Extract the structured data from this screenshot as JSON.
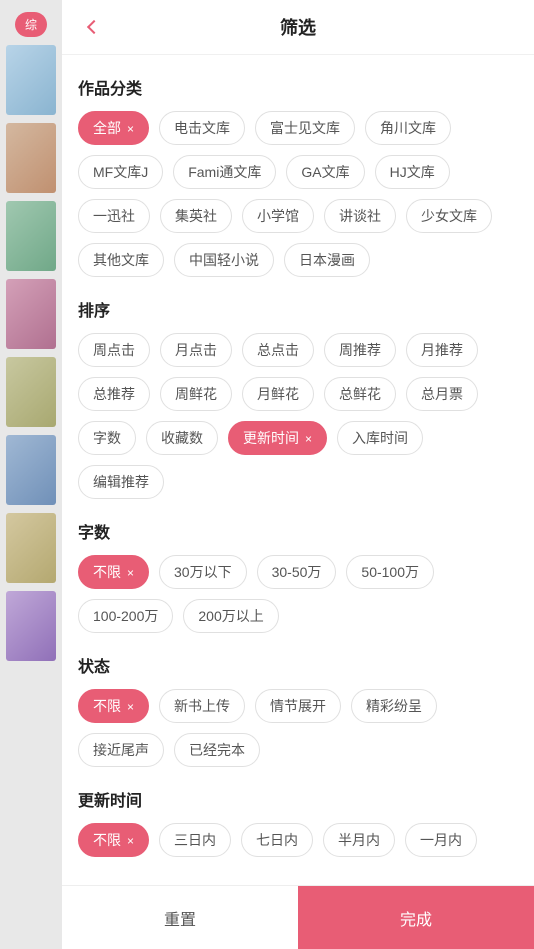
{
  "header": {
    "title": "筛选",
    "back_label": "back"
  },
  "sections": {
    "category": {
      "title": "作品分类",
      "tags": [
        {
          "label": "全部",
          "active": true
        },
        {
          "label": "电击文库",
          "active": false
        },
        {
          "label": "富士见文库",
          "active": false
        },
        {
          "label": "角川文库",
          "active": false
        },
        {
          "label": "MF文库J",
          "active": false
        },
        {
          "label": "Fami通文库",
          "active": false
        },
        {
          "label": "GA文库",
          "active": false
        },
        {
          "label": "HJ文库",
          "active": false
        },
        {
          "label": "一迅社",
          "active": false
        },
        {
          "label": "集英社",
          "active": false
        },
        {
          "label": "小学馆",
          "active": false
        },
        {
          "label": "讲谈社",
          "active": false
        },
        {
          "label": "少女文库",
          "active": false
        },
        {
          "label": "其他文库",
          "active": false
        },
        {
          "label": "中国轻小说",
          "active": false
        },
        {
          "label": "日本漫画",
          "active": false
        }
      ]
    },
    "sort": {
      "title": "排序",
      "tags": [
        {
          "label": "周点击",
          "active": false
        },
        {
          "label": "月点击",
          "active": false
        },
        {
          "label": "总点击",
          "active": false
        },
        {
          "label": "周推荐",
          "active": false
        },
        {
          "label": "月推荐",
          "active": false
        },
        {
          "label": "总推荐",
          "active": false
        },
        {
          "label": "周鲜花",
          "active": false
        },
        {
          "label": "月鲜花",
          "active": false
        },
        {
          "label": "总鲜花",
          "active": false
        },
        {
          "label": "总月票",
          "active": false
        },
        {
          "label": "字数",
          "active": false
        },
        {
          "label": "收藏数",
          "active": false
        },
        {
          "label": "更新时间",
          "active": true
        },
        {
          "label": "入库时间",
          "active": false
        },
        {
          "label": "编辑推荐",
          "active": false
        }
      ]
    },
    "word_count": {
      "title": "字数",
      "tags": [
        {
          "label": "不限",
          "active": true
        },
        {
          "label": "30万以下",
          "active": false
        },
        {
          "label": "30-50万",
          "active": false
        },
        {
          "label": "50-100万",
          "active": false
        },
        {
          "label": "100-200万",
          "active": false
        },
        {
          "label": "200万以上",
          "active": false
        }
      ]
    },
    "status": {
      "title": "状态",
      "tags": [
        {
          "label": "不限",
          "active": true
        },
        {
          "label": "新书上传",
          "active": false
        },
        {
          "label": "情节展开",
          "active": false
        },
        {
          "label": "精彩纷呈",
          "active": false
        },
        {
          "label": "接近尾声",
          "active": false
        },
        {
          "label": "已经完本",
          "active": false
        }
      ]
    },
    "update_time": {
      "title": "更新时间",
      "tags": [
        {
          "label": "不限",
          "active": true
        },
        {
          "label": "三日内",
          "active": false
        },
        {
          "label": "七日内",
          "active": false
        },
        {
          "label": "半月内",
          "active": false
        },
        {
          "label": "一月内",
          "active": false
        }
      ]
    }
  },
  "footer": {
    "reset_label": "重置",
    "confirm_label": "完成"
  },
  "sidebar": {
    "selected_label": "综"
  },
  "colors": {
    "accent": "#e85d75"
  }
}
